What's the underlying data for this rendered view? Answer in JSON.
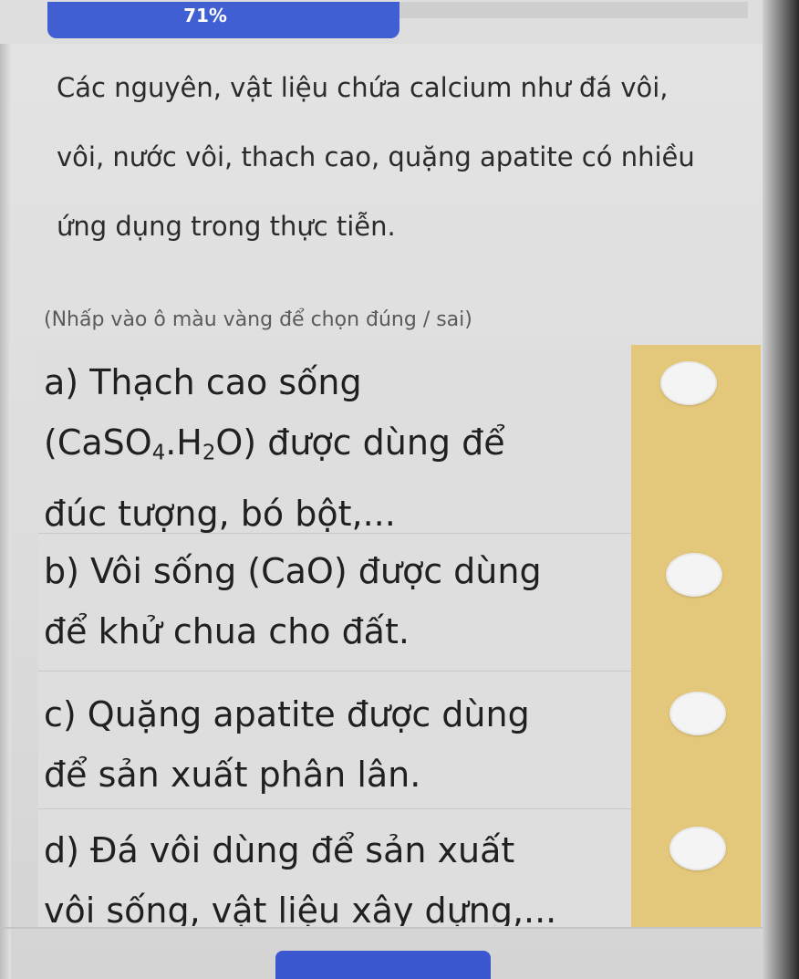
{
  "progress": {
    "label": "71%",
    "value_percent": 71
  },
  "intro": {
    "line1": "Các nguyên, vật liệu chứa calcium như đá vôi,",
    "line2": "vôi, nước vôi, thach cao, quặng apatite có nhiều",
    "line3": "ứng dụng trong thực tiễn."
  },
  "hint": "(Nhấp vào ô màu vàng để chọn đúng / sai)",
  "options": [
    {
      "line1": "a) Thạch cao sống",
      "formula_open": "(CaSO",
      "formula_sub1": "4",
      "formula_mid": ".H",
      "formula_sub2": "2",
      "formula_close": "O)",
      "line2_rest": " được dùng để",
      "line3": "đúc tượng, bó bột,..."
    },
    {
      "line1": "b) Vôi sống (CaO) được dùng",
      "line2": "để khử chua cho đất."
    },
    {
      "line1": "c) Quặng apatite được dùng",
      "line2": "để sản xuất phân lân."
    },
    {
      "line1": "d) Đá vôi dùng để sản xuất",
      "line2": "vôi sống, vật liệu xây dựng,..."
    }
  ],
  "colors": {
    "progress_blue": "#3f5fd3",
    "answer_column": "#e3c77a",
    "answer_circle": "#f4f4f4",
    "button_blue": "#3a57cf"
  }
}
